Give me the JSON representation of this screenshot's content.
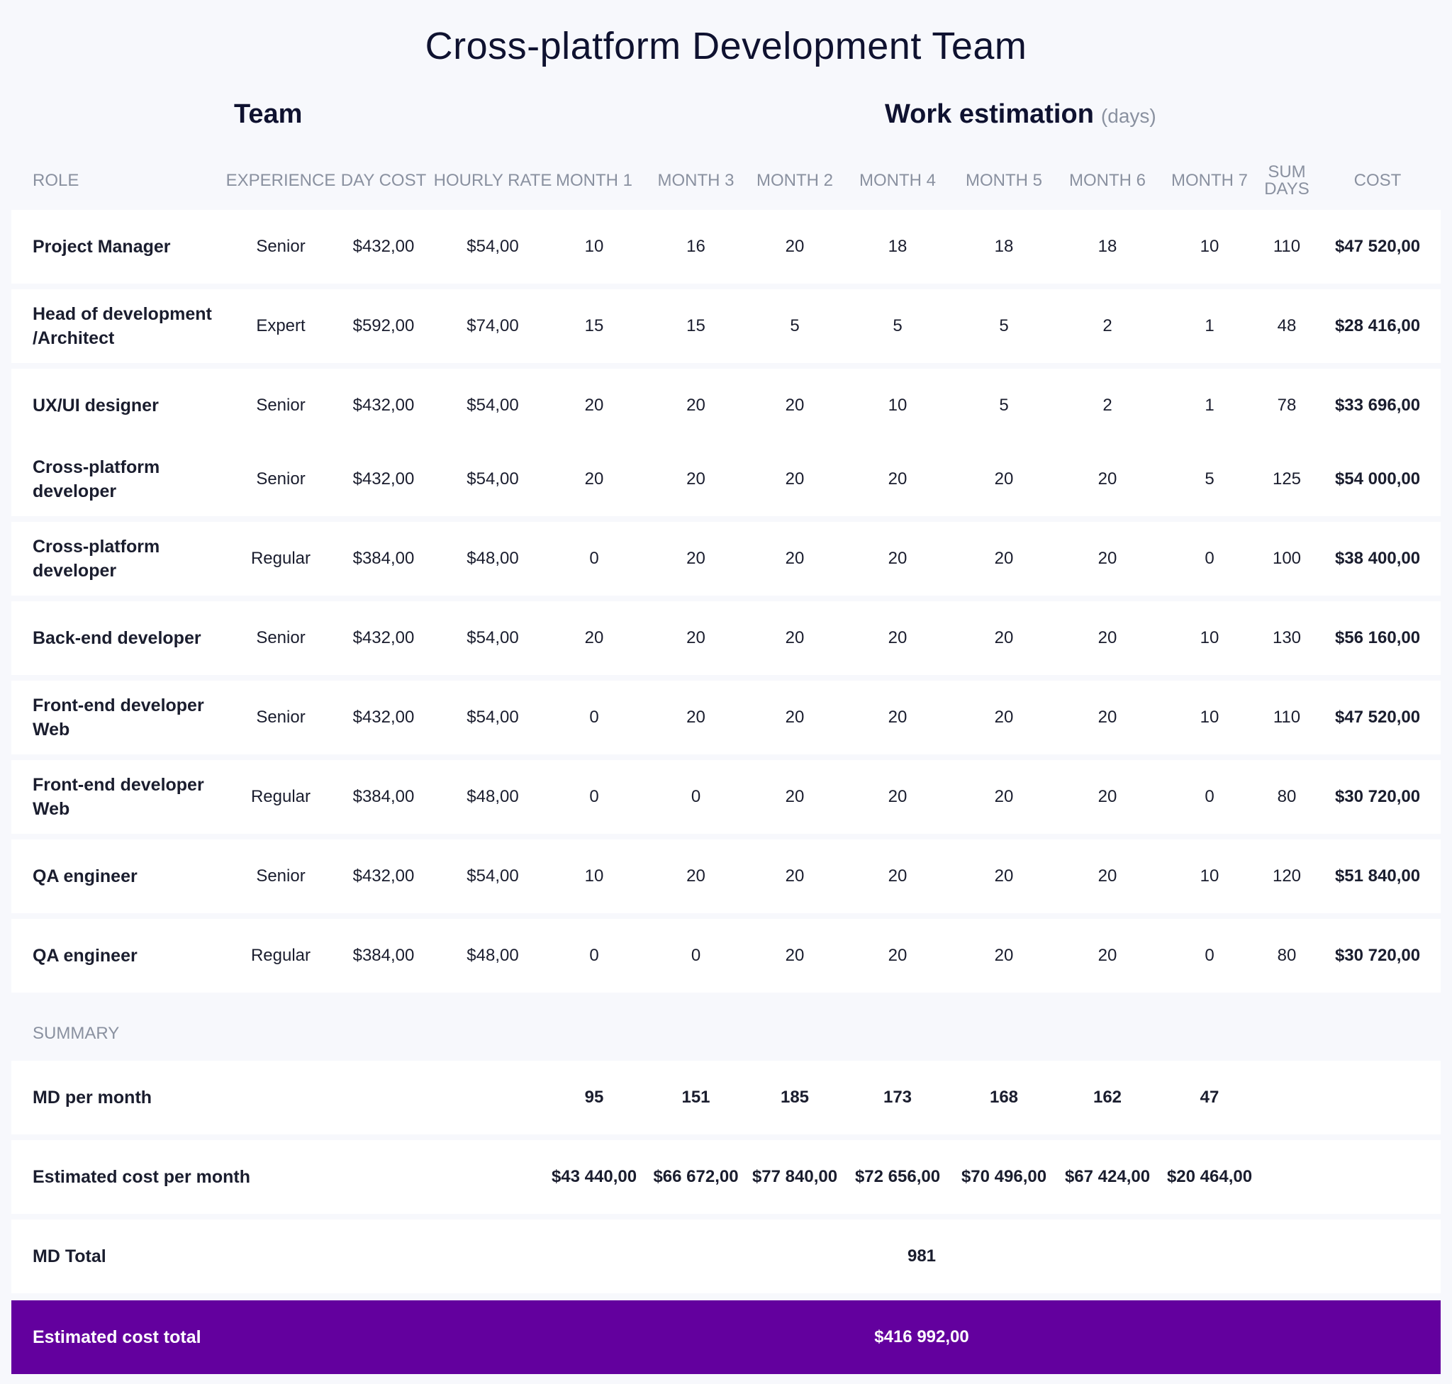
{
  "title": "Cross-platform Development Team",
  "sections": {
    "team": "Team",
    "work": "Work estimation",
    "work_unit": "(days)"
  },
  "columns": {
    "role": "ROLE",
    "experience": "EXPERIENCE",
    "day_cost": "DAY COST",
    "hourly_rate": "HOURLY RATE",
    "m1": "MONTH 1",
    "m3": "MONTH 3",
    "m2": "MONTH 2",
    "m4": "MONTH 4",
    "m5": "MONTH 5",
    "m6": "MONTH 6",
    "m7": "MONTH 7",
    "sum_days": "SUM DAYS",
    "cost": "COST"
  },
  "rows": [
    {
      "role": "Project Manager",
      "experience": "Senior",
      "day_cost": "$432,00",
      "hourly_rate": "$54,00",
      "months": [
        "10",
        "16",
        "20",
        "18",
        "18",
        "18",
        "10"
      ],
      "sum": "110",
      "cost": "$47 520,00"
    },
    {
      "role": "Head of development /Architect",
      "experience": "Expert",
      "day_cost": "$592,00",
      "hourly_rate": "$74,00",
      "months": [
        "15",
        "15",
        "5",
        "5",
        "5",
        "2",
        "1"
      ],
      "sum": "48",
      "cost": "$28 416,00"
    },
    {
      "role": "UX/UI designer",
      "experience": "Senior",
      "day_cost": "$432,00",
      "hourly_rate": "$54,00",
      "months": [
        "20",
        "20",
        "20",
        "10",
        "5",
        "2",
        "1"
      ],
      "sum": "78",
      "cost": "$33 696,00"
    },
    {
      "role": "Cross-platform developer",
      "experience": "Senior",
      "day_cost": "$432,00",
      "hourly_rate": "$54,00",
      "months": [
        "20",
        "20",
        "20",
        "20",
        "20",
        "20",
        "5"
      ],
      "sum": "125",
      "cost": "$54 000,00"
    },
    {
      "role": "Cross-platform developer",
      "experience": "Regular",
      "day_cost": "$384,00",
      "hourly_rate": "$48,00",
      "months": [
        "0",
        "20",
        "20",
        "20",
        "20",
        "20",
        "0"
      ],
      "sum": "100",
      "cost": "$38 400,00"
    },
    {
      "role": "Back-end developer",
      "experience": "Senior",
      "day_cost": "$432,00",
      "hourly_rate": "$54,00",
      "months": [
        "20",
        "20",
        "20",
        "20",
        "20",
        "20",
        "10"
      ],
      "sum": "130",
      "cost": "$56 160,00"
    },
    {
      "role": "Front-end developer Web",
      "experience": "Senior",
      "day_cost": "$432,00",
      "hourly_rate": "$54,00",
      "months": [
        "0",
        "20",
        "20",
        "20",
        "20",
        "20",
        "10"
      ],
      "sum": "110",
      "cost": "$47 520,00"
    },
    {
      "role": "Front-end developer Web",
      "experience": "Regular",
      "day_cost": "$384,00",
      "hourly_rate": "$48,00",
      "months": [
        "0",
        "0",
        "20",
        "20",
        "20",
        "20",
        "0"
      ],
      "sum": "80",
      "cost": "$30 720,00"
    },
    {
      "role": "QA engineer",
      "experience": "Senior",
      "day_cost": "$432,00",
      "hourly_rate": "$54,00",
      "months": [
        "10",
        "20",
        "20",
        "20",
        "20",
        "20",
        "10"
      ],
      "sum": "120",
      "cost": "$51 840,00"
    },
    {
      "role": "QA engineer",
      "experience": "Regular",
      "day_cost": "$384,00",
      "hourly_rate": "$48,00",
      "months": [
        "0",
        "0",
        "20",
        "20",
        "20",
        "20",
        "0"
      ],
      "sum": "80",
      "cost": "$30 720,00"
    }
  ],
  "summary": {
    "label": "SUMMARY",
    "md_per_month": {
      "label": "MD per month",
      "values": [
        "95",
        "151",
        "185",
        "173",
        "168",
        "162",
        "47"
      ]
    },
    "cost_per_month": {
      "label": "Estimated cost per month",
      "values": [
        "$43 440,00",
        "$66 672,00",
        "$77 840,00",
        "$72 656,00",
        "$70 496,00",
        "$67 424,00",
        "$20 464,00"
      ]
    },
    "md_total": {
      "label": "MD Total",
      "value": "981"
    },
    "cost_total": {
      "label": "Estimated cost total",
      "value": "$416 992,00"
    }
  },
  "colors": {
    "accent": "#63009e",
    "background": "#f7f8fc",
    "muted": "#8a91a0"
  }
}
